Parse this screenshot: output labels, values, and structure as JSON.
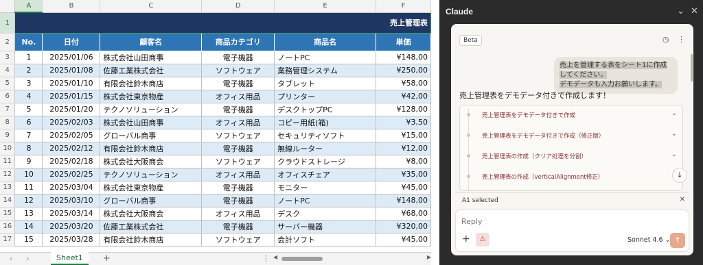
{
  "sheet": {
    "columns": [
      "A",
      "B",
      "C",
      "D",
      "E",
      "F"
    ],
    "row_numbers": [
      "1",
      "2",
      "3",
      "4",
      "5",
      "6",
      "7",
      "8",
      "9",
      "10",
      "11",
      "12",
      "13",
      "14",
      "15",
      "16",
      "17"
    ],
    "title": "売上管理表",
    "headers": [
      "No.",
      "日付",
      "顧客名",
      "商品カテゴリ",
      "商品名",
      "単価"
    ],
    "rows": [
      [
        "1",
        "2025/01/06",
        "株式会社山田商事",
        "電子機器",
        "ノートPC",
        "¥148,00"
      ],
      [
        "2",
        "2025/01/08",
        "佐藤工業株式会社",
        "ソフトウェア",
        "業務管理システム",
        "¥250,00"
      ],
      [
        "3",
        "2025/01/10",
        "有限会社鈴木商店",
        "電子機器",
        "タブレット",
        "¥58,00"
      ],
      [
        "4",
        "2025/01/15",
        "株式会社東京物産",
        "オフィス用品",
        "プリンター",
        "¥42,00"
      ],
      [
        "5",
        "2025/01/20",
        "テクノソリューション",
        "電子機器",
        "デスクトップPC",
        "¥128,00"
      ],
      [
        "6",
        "2025/02/03",
        "株式会社山田商事",
        "オフィス用品",
        "コピー用紙(箱)",
        "¥3,50"
      ],
      [
        "7",
        "2025/02/05",
        "グローバル商事",
        "ソフトウェア",
        "セキュリティソフト",
        "¥15,00"
      ],
      [
        "8",
        "2025/02/12",
        "有限会社鈴木商店",
        "電子機器",
        "無線ルーター",
        "¥12,00"
      ],
      [
        "9",
        "2025/02/18",
        "株式会社大阪商会",
        "ソフトウェア",
        "クラウドストレージ",
        "¥8,00"
      ],
      [
        "10",
        "2025/02/25",
        "テクノソリューション",
        "オフィス用品",
        "オフィスチェア",
        "¥35,00"
      ],
      [
        "11",
        "2025/03/04",
        "株式会社東京物産",
        "電子機器",
        "モニター",
        "¥45,00"
      ],
      [
        "12",
        "2025/03/10",
        "グローバル商事",
        "電子機器",
        "ノートPC",
        "¥148,00"
      ],
      [
        "13",
        "2025/03/14",
        "株式会社大阪商会",
        "オフィス用品",
        "デスク",
        "¥68,00"
      ],
      [
        "14",
        "2025/03/20",
        "佐藤工業株式会社",
        "電子機器",
        "サーバー機器",
        "¥320,00"
      ],
      [
        "15",
        "2025/03/28",
        "有限会社鈴木商店",
        "ソフトウェア",
        "会計ソフト",
        "¥45,00"
      ]
    ],
    "tab_name": "Sheet1",
    "add_sheet": "+",
    "more": "⋮"
  },
  "claude": {
    "title": "Claude",
    "beta": "Beta",
    "user_message_line1": "売上を管理する表をシート1に作成してください。",
    "user_message_line2": "デモデータも入力お願いします。",
    "assistant_text": "売上管理表をデモデータ付きで作成します！",
    "steps": [
      "売上管理表をデモデータ付きで作成",
      "売上管理表をデモデータ付きで作成（修正版）",
      "売上管理表の作成（クリア処理を分割）",
      "売上管理表の作成（verticalAlignment修正）"
    ],
    "selection": "A1 selected",
    "reply_placeholder": "Reply",
    "model": "Sonnet 4.6"
  },
  "colors": {
    "title_bg": "#1f3863",
    "header_bg": "#2e75b6",
    "alt_row_bg": "#ddebf7",
    "panel_bg": "#2b2b2b",
    "send_btn": "#e7a98d"
  }
}
